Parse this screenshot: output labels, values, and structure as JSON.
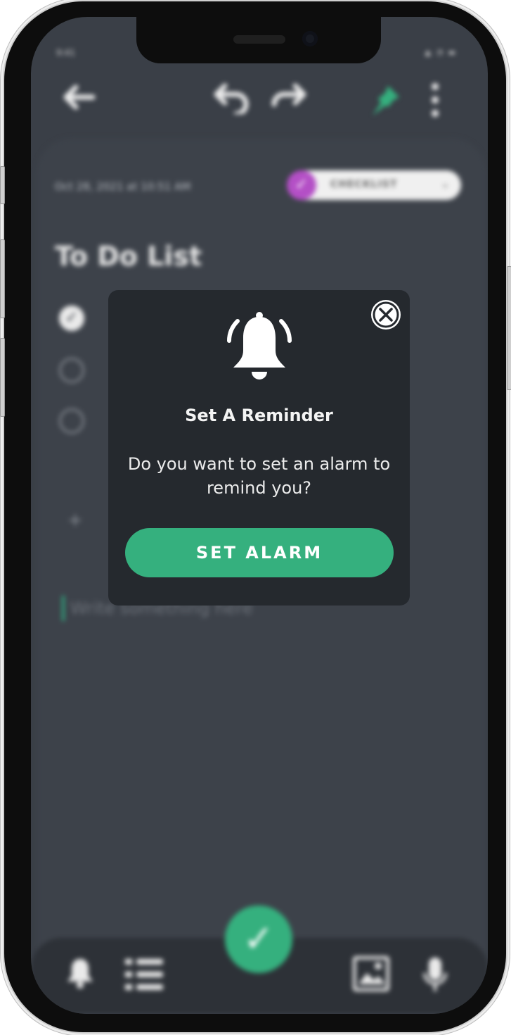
{
  "status": {
    "time": "9:41",
    "icons": "▲ ◔ ▬"
  },
  "topbar": {
    "back_icon": "arrow-left-icon",
    "undo_icon": "undo-icon",
    "redo_icon": "redo-icon",
    "pin_icon": "pin-icon",
    "more_icon": "more-vertical-icon"
  },
  "note": {
    "date": "Oct 28, 2021 at 10:51 AM",
    "type_label": "CHECKLIST",
    "title": "To Do List",
    "placeholder": "Write something here"
  },
  "dialog": {
    "title": "Set A Reminder",
    "message": "Do you want to set an alarm to remind you?",
    "button": "SET ALARM"
  },
  "colors": {
    "accent_green": "#35b07e",
    "checklist_purple": "#b44fc6",
    "dialog_bg": "#25292e",
    "screen_bg": "#3a3f47"
  }
}
